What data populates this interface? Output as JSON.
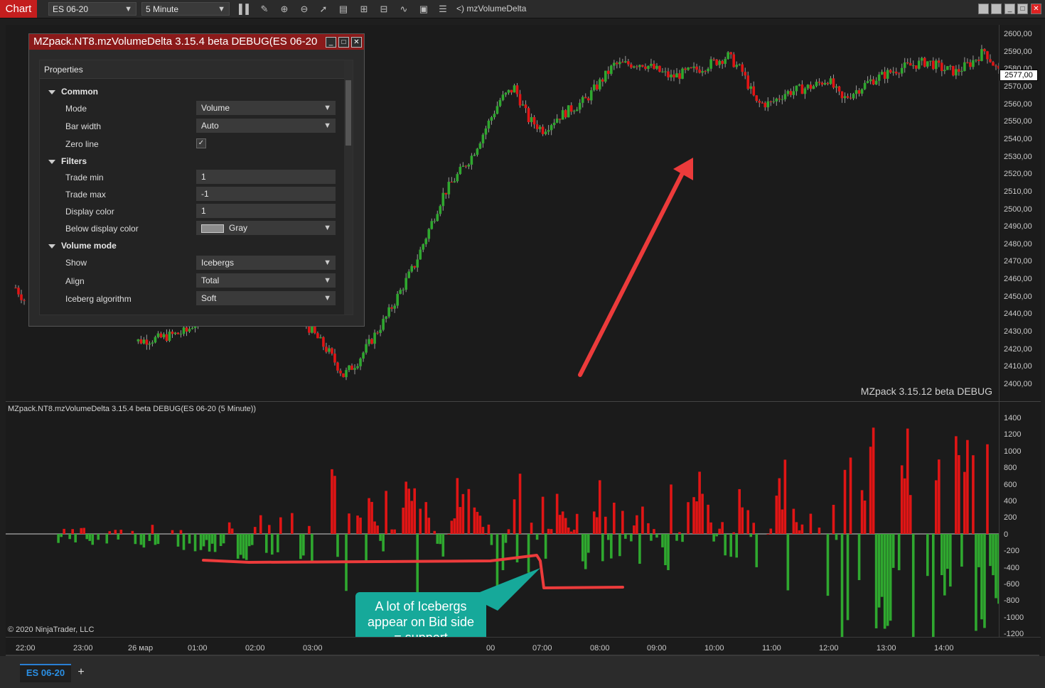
{
  "toolbar": {
    "app_label": "Chart",
    "instrument": "ES 06-20",
    "interval": "5 Minute",
    "indicator_label": "<) mzVolumeDelta",
    "icons": [
      "bar-type-icon",
      "draw-tool-icon",
      "zoom-in-icon",
      "zoom-out-icon",
      "pointer-icon",
      "properties-icon",
      "templates-icon",
      "strategies-icon",
      "indicators-icon",
      "data-box-icon",
      "list-icon"
    ]
  },
  "window_buttons": [
    "min",
    "max-1",
    "max-2",
    "close"
  ],
  "price_axis": [
    "2600,00",
    "2590,00",
    "2580,00",
    "2570,00",
    "2560,00",
    "2550,00",
    "2540,00",
    "2530,00",
    "2520,00",
    "2510,00",
    "2500,00",
    "2490,00",
    "2480,00",
    "2470,00",
    "2460,00",
    "2450,00",
    "2440,00",
    "2430,00",
    "2420,00",
    "2410,00",
    "2400,00"
  ],
  "current_price": "2577,00",
  "watermark": "MZpack 3.15.12 beta DEBUG",
  "lower_panel": {
    "title": "MZpack.NT8.mzVolumeDelta 3.15.4 beta DEBUG(ES 06-20 (5 Minute))",
    "axis": [
      "1400",
      "1200",
      "1000",
      "800",
      "600",
      "400",
      "200",
      "0",
      "-200",
      "-400",
      "-600",
      "-800",
      "-1000",
      "-1200"
    ]
  },
  "copyright": "© 2020 NinjaTrader, LLC",
  "time_axis": [
    "22:00",
    "23:00",
    "26 мар",
    "01:00",
    "02:00",
    "03:00",
    "00",
    "07:00",
    "08:00",
    "09:00",
    "10:00",
    "11:00",
    "12:00",
    "13:00",
    "14:00"
  ],
  "properties_window": {
    "title": "MZpack.NT8.mzVolumeDelta 3.15.4 beta DEBUG(ES 06-20",
    "header": "Properties",
    "sections": {
      "common": "Common",
      "filters": "Filters",
      "volume_mode": "Volume mode"
    },
    "props": {
      "mode": {
        "label": "Mode",
        "value": "Volume"
      },
      "bar_width": {
        "label": "Bar width",
        "value": "Auto"
      },
      "zero_line": {
        "label": "Zero line",
        "value": "✓"
      },
      "trade_min": {
        "label": "Trade min",
        "value": "1"
      },
      "trade_max": {
        "label": "Trade max",
        "value": "-1"
      },
      "display_color": {
        "label": "Display color",
        "value": "1"
      },
      "below_display_color": {
        "label": "Below display color",
        "value": "Gray"
      },
      "show": {
        "label": "Show",
        "value": "Icebergs"
      },
      "align": {
        "label": "Align",
        "value": "Total"
      },
      "iceberg_algorithm": {
        "label": "Iceberg algorithm",
        "value": "Soft"
      }
    }
  },
  "callout": {
    "line1": "A lot of Icebergs",
    "line2": "appear on Bid side",
    "line3": "= support"
  },
  "tabs": {
    "active": "ES 06-20",
    "add": "+"
  },
  "colors": {
    "up": "#2fa82f",
    "down": "#e01515",
    "annotation": "#ec3b3b",
    "callout": "#16a99a",
    "title_bar": "#8b1a1a",
    "tab_accent": "#2a7fd4"
  },
  "chart_data": [
    {
      "type": "candlestick",
      "title": "",
      "xlabel": "",
      "ylabel": "",
      "ylim": [
        2400,
        2600
      ],
      "close_path": [
        [
          0,
          2455
        ],
        [
          10,
          2432
        ],
        [
          20,
          2420
        ],
        [
          30,
          2419
        ],
        [
          40,
          2424
        ],
        [
          50,
          2426
        ],
        [
          60,
          2430
        ],
        [
          70,
          2448
        ],
        [
          80,
          2443
        ],
        [
          90,
          2441
        ],
        [
          100,
          2438
        ],
        [
          110,
          2418
        ],
        [
          115,
          2405
        ],
        [
          120,
          2413
        ],
        [
          130,
          2438
        ],
        [
          140,
          2468
        ],
        [
          150,
          2508
        ],
        [
          160,
          2530
        ],
        [
          170,
          2562
        ],
        [
          175,
          2569
        ],
        [
          180,
          2551
        ],
        [
          185,
          2545
        ],
        [
          190,
          2552
        ],
        [
          200,
          2562
        ],
        [
          210,
          2582
        ],
        [
          220,
          2583
        ],
        [
          230,
          2575
        ],
        [
          240,
          2580
        ],
        [
          250,
          2587
        ],
        [
          255,
          2578
        ],
        [
          260,
          2560
        ],
        [
          265,
          2560
        ],
        [
          270,
          2566
        ],
        [
          280,
          2570
        ],
        [
          285,
          2574
        ],
        [
          290,
          2562
        ],
        [
          300,
          2573
        ],
        [
          310,
          2580
        ],
        [
          320,
          2584
        ],
        [
          325,
          2580
        ],
        [
          330,
          2578
        ],
        [
          335,
          2583
        ],
        [
          340,
          2590
        ],
        [
          345,
          2578
        ]
      ]
    },
    {
      "type": "bar",
      "title": "",
      "ylim": [
        -1200,
        1500
      ],
      "delta_path": [
        [
          0,
          -60
        ],
        [
          20,
          -110
        ],
        [
          40,
          -150
        ],
        [
          60,
          -170
        ],
        [
          80,
          -260
        ],
        [
          90,
          -400
        ],
        [
          95,
          -550
        ],
        [
          100,
          -500
        ],
        [
          105,
          500
        ],
        [
          110,
          650
        ],
        [
          115,
          800
        ],
        [
          120,
          550
        ],
        [
          125,
          600
        ],
        [
          130,
          -550
        ],
        [
          135,
          450
        ],
        [
          140,
          700
        ],
        [
          145,
          350
        ],
        [
          150,
          -400
        ],
        [
          155,
          600
        ],
        [
          160,
          700
        ],
        [
          170,
          -700
        ],
        [
          175,
          650
        ],
        [
          180,
          550
        ],
        [
          185,
          -500
        ],
        [
          190,
          600
        ],
        [
          200,
          -550
        ],
        [
          205,
          750
        ],
        [
          210,
          -650
        ],
        [
          220,
          600
        ],
        [
          230,
          -700
        ],
        [
          235,
          500
        ],
        [
          240,
          680
        ],
        [
          250,
          -500
        ],
        [
          255,
          800
        ],
        [
          260,
          -600
        ],
        [
          270,
          900
        ],
        [
          280,
          -800
        ],
        [
          285,
          1400
        ],
        [
          290,
          -1100
        ]
      ]
    }
  ]
}
